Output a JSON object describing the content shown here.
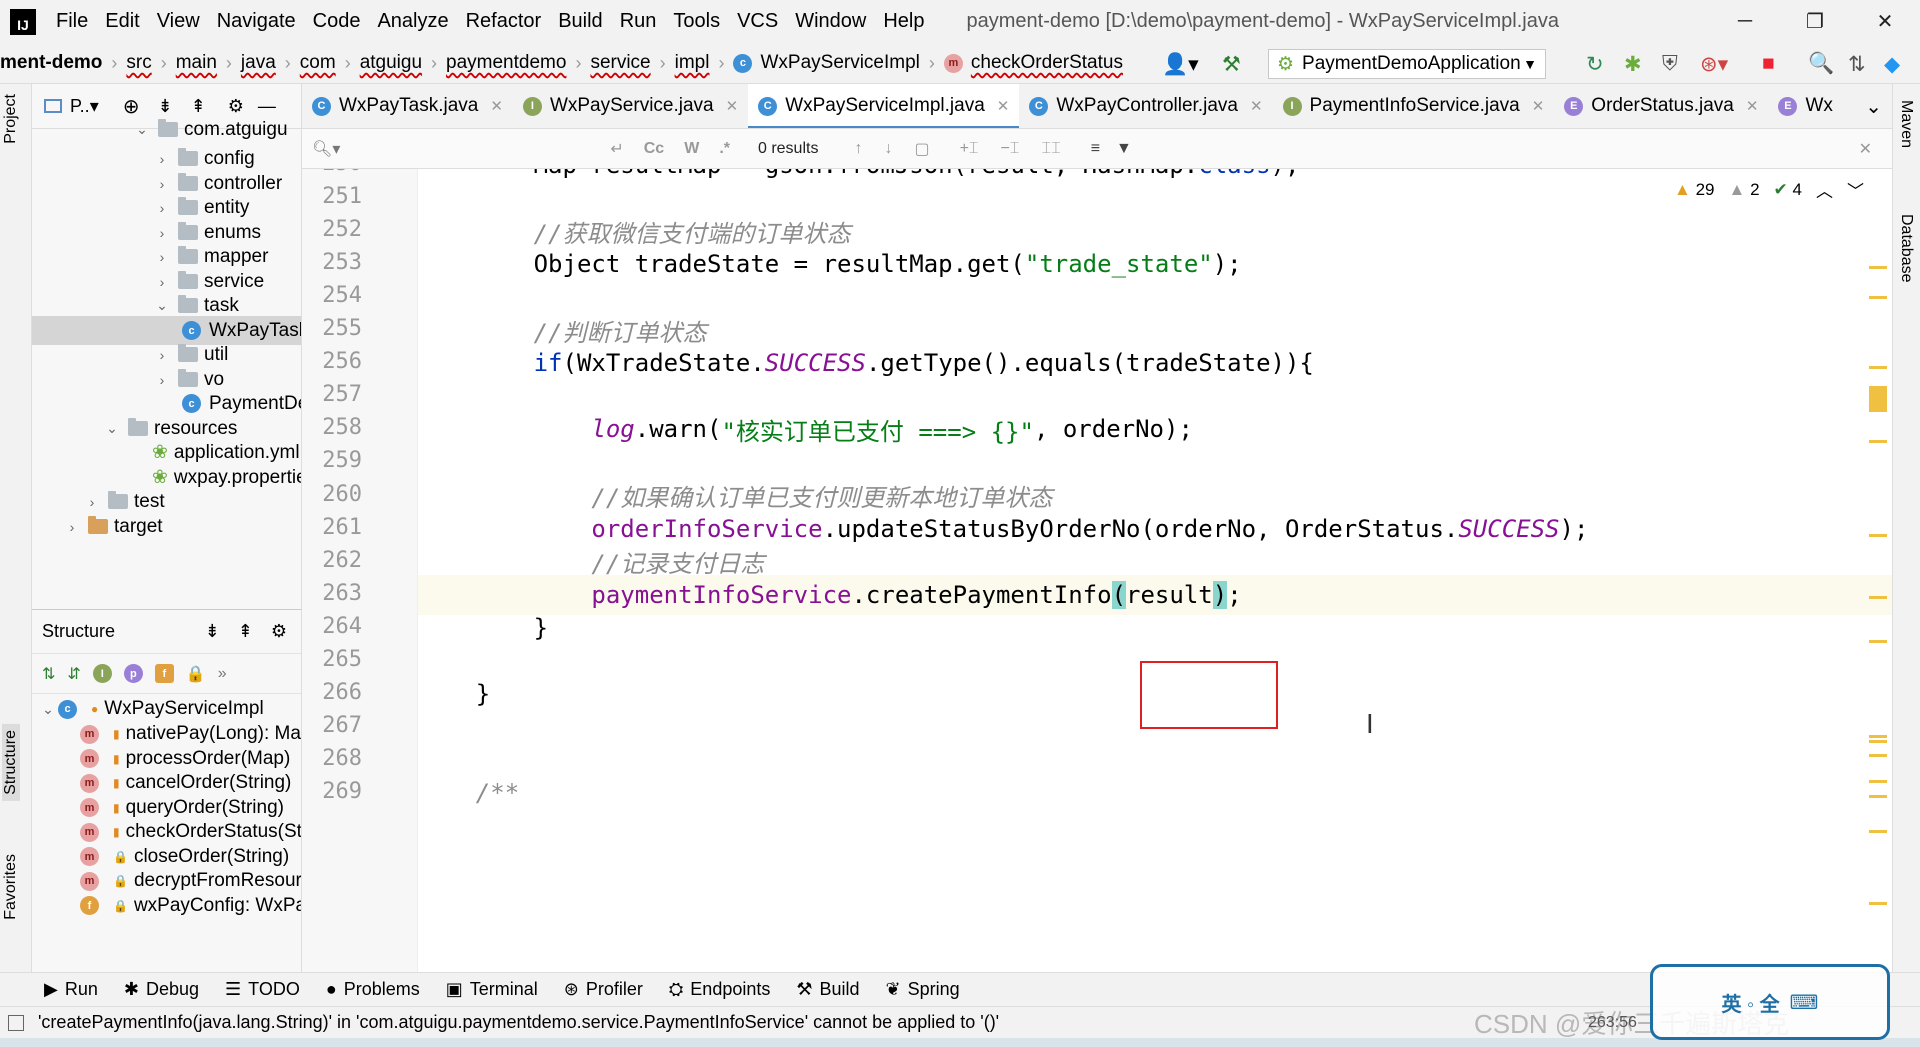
{
  "titlebar": {
    "menus": [
      "File",
      "Edit",
      "View",
      "Navigate",
      "Code",
      "Analyze",
      "Refactor",
      "Build",
      "Run",
      "Tools",
      "VCS",
      "Window",
      "Help"
    ],
    "title": "payment-demo [D:\\demo\\payment-demo] - WxPayServiceImpl.java"
  },
  "navbar": {
    "crumbs": [
      "ment-demo",
      "src",
      "main",
      "java",
      "com",
      "atguigu",
      "paymentdemo",
      "service",
      "impl",
      "WxPayServiceImpl",
      "checkOrderStatus"
    ],
    "run_config": "PaymentDemoApplication"
  },
  "left_stripe": {
    "project_tab": "Project",
    "structure_tab": "Structure",
    "favorites_tab": "Favorites"
  },
  "project": {
    "header": "P..▾",
    "items": [
      {
        "label": "com.atguigu",
        "type": "package"
      },
      {
        "label": "config",
        "type": "folder"
      },
      {
        "label": "controller",
        "type": "folder"
      },
      {
        "label": "entity",
        "type": "folder"
      },
      {
        "label": "enums",
        "type": "folder"
      },
      {
        "label": "mapper",
        "type": "folder"
      },
      {
        "label": "service",
        "type": "folder"
      },
      {
        "label": "task",
        "type": "folder"
      },
      {
        "label": "WxPayTask",
        "type": "class"
      },
      {
        "label": "util",
        "type": "folder"
      },
      {
        "label": "vo",
        "type": "folder"
      },
      {
        "label": "PaymentDemoApplication",
        "type": "class"
      },
      {
        "label": "resources",
        "type": "folder"
      },
      {
        "label": "application.yml",
        "type": "file"
      },
      {
        "label": "wxpay.properties",
        "type": "file"
      },
      {
        "label": "test",
        "type": "folder"
      },
      {
        "label": "target",
        "type": "folder"
      }
    ]
  },
  "structure": {
    "title": "Structure",
    "root": "WxPayServiceImpl",
    "members": [
      {
        "kind": "m",
        "label": "nativePay(Long): Map"
      },
      {
        "kind": "m",
        "label": "processOrder(Map)"
      },
      {
        "kind": "m",
        "label": "cancelOrder(String)"
      },
      {
        "kind": "m",
        "label": "queryOrder(String)"
      },
      {
        "kind": "m",
        "label": "checkOrderStatus(String)"
      },
      {
        "kind": "m",
        "label": "closeOrder(String)"
      },
      {
        "kind": "m",
        "label": "decryptFromResource(Map)"
      },
      {
        "kind": "f",
        "label": "wxPayConfig: WxPayConfig"
      }
    ]
  },
  "tabs": [
    {
      "label": "WxPayTask.java",
      "icon": "C",
      "active": false
    },
    {
      "label": "WxPayService.java",
      "icon": "I",
      "active": false
    },
    {
      "label": "WxPayServiceImpl.java",
      "icon": "C",
      "active": true
    },
    {
      "label": "WxPayController.java",
      "icon": "C",
      "active": false
    },
    {
      "label": "PaymentInfoService.java",
      "icon": "I",
      "active": false
    },
    {
      "label": "OrderStatus.java",
      "icon": "E",
      "active": false
    },
    {
      "label": "Wx",
      "icon": "E",
      "active": false
    }
  ],
  "search": {
    "results": "0 results",
    "match_case": "Cc",
    "words": "W",
    "regex": ".*"
  },
  "inspections": {
    "warnings": "29",
    "weak_warnings": "2",
    "ok": "4"
  },
  "code": [
    {
      "n": "250",
      "parts": [
        [
          "t",
          "        Map resultMap = gson.fromJson(result, HashMap."
        ],
        [
          "kw",
          "class"
        ],
        [
          "t",
          ");"
        ]
      ]
    },
    {
      "n": "251",
      "parts": []
    },
    {
      "n": "252",
      "parts": [
        [
          "cmt",
          "        //获取微信支付端的订单状态"
        ]
      ]
    },
    {
      "n": "253",
      "parts": [
        [
          "t",
          "        Object tradeState = resultMap.get("
        ],
        [
          "str",
          "\"trade_state\""
        ],
        [
          "t",
          ");"
        ]
      ]
    },
    {
      "n": "254",
      "parts": []
    },
    {
      "n": "255",
      "parts": [
        [
          "cmt",
          "        //判断订单状态"
        ]
      ]
    },
    {
      "n": "256",
      "parts": [
        [
          "t",
          "        "
        ],
        [
          "kw",
          "if"
        ],
        [
          "t",
          "(WxTradeState."
        ],
        [
          "sfld",
          "SUCCESS"
        ],
        [
          "t",
          ".getType().equals(tradeState)){"
        ]
      ]
    },
    {
      "n": "257",
      "parts": []
    },
    {
      "n": "258",
      "parts": [
        [
          "t",
          "            "
        ],
        [
          "sfld",
          "log"
        ],
        [
          "t",
          ".warn("
        ],
        [
          "str",
          "\"核实订单已支付 ===> {}\""
        ],
        [
          "t",
          ", orderNo);"
        ]
      ]
    },
    {
      "n": "259",
      "parts": []
    },
    {
      "n": "260",
      "parts": [
        [
          "cmt",
          "            //如果确认订单已支付则更新本地订单状态"
        ]
      ]
    },
    {
      "n": "261",
      "parts": [
        [
          "t",
          "            "
        ],
        [
          "fld",
          "orderInfoService"
        ],
        [
          "t",
          ".updateStatusByOrderNo(orderNo, OrderStatus."
        ],
        [
          "sfld",
          "SUCCESS"
        ],
        [
          "t",
          ");"
        ]
      ]
    },
    {
      "n": "262",
      "parts": [
        [
          "cmt",
          "            //记录支付日志"
        ]
      ]
    },
    {
      "n": "263",
      "parts": [
        [
          "t",
          "            "
        ],
        [
          "fld",
          "paymentInfoService"
        ],
        [
          "t",
          ".createPaymentInfo"
        ],
        [
          "sel",
          "("
        ],
        [
          "t",
          "result"
        ],
        [
          "sel",
          ")"
        ],
        [
          "t",
          ";"
        ]
      ]
    },
    {
      "n": "264",
      "parts": [
        [
          "t",
          "        }"
        ]
      ]
    },
    {
      "n": "265",
      "parts": []
    },
    {
      "n": "266",
      "parts": [
        [
          "t",
          "    }"
        ]
      ]
    },
    {
      "n": "267",
      "parts": []
    },
    {
      "n": "268",
      "parts": []
    },
    {
      "n": "269",
      "parts": [
        [
          "cmt",
          "    /**"
        ]
      ]
    }
  ],
  "right_stripe": {
    "maven": "Maven",
    "database": "Database"
  },
  "toolwindows": [
    "Run",
    "Debug",
    "TODO",
    "Problems",
    "Terminal",
    "Profiler",
    "Endpoints",
    "Build",
    "Spring"
  ],
  "status": {
    "message": "'createPaymentInfo(java.lang.String)' in 'com.atguigu.paymentdemo.service.PaymentInfoService' cannot be applied to '()'",
    "position": "263:56"
  },
  "overlay": {
    "ime": "英 ◦ 全",
    "watermark": "CSDN @爱你三千遍斯塔克"
  },
  "colors": {
    "keyword": "#0033b3",
    "string": "#067d17",
    "comment": "#8c8c8c",
    "field": "#871094",
    "highlight_box": "#e02020"
  }
}
